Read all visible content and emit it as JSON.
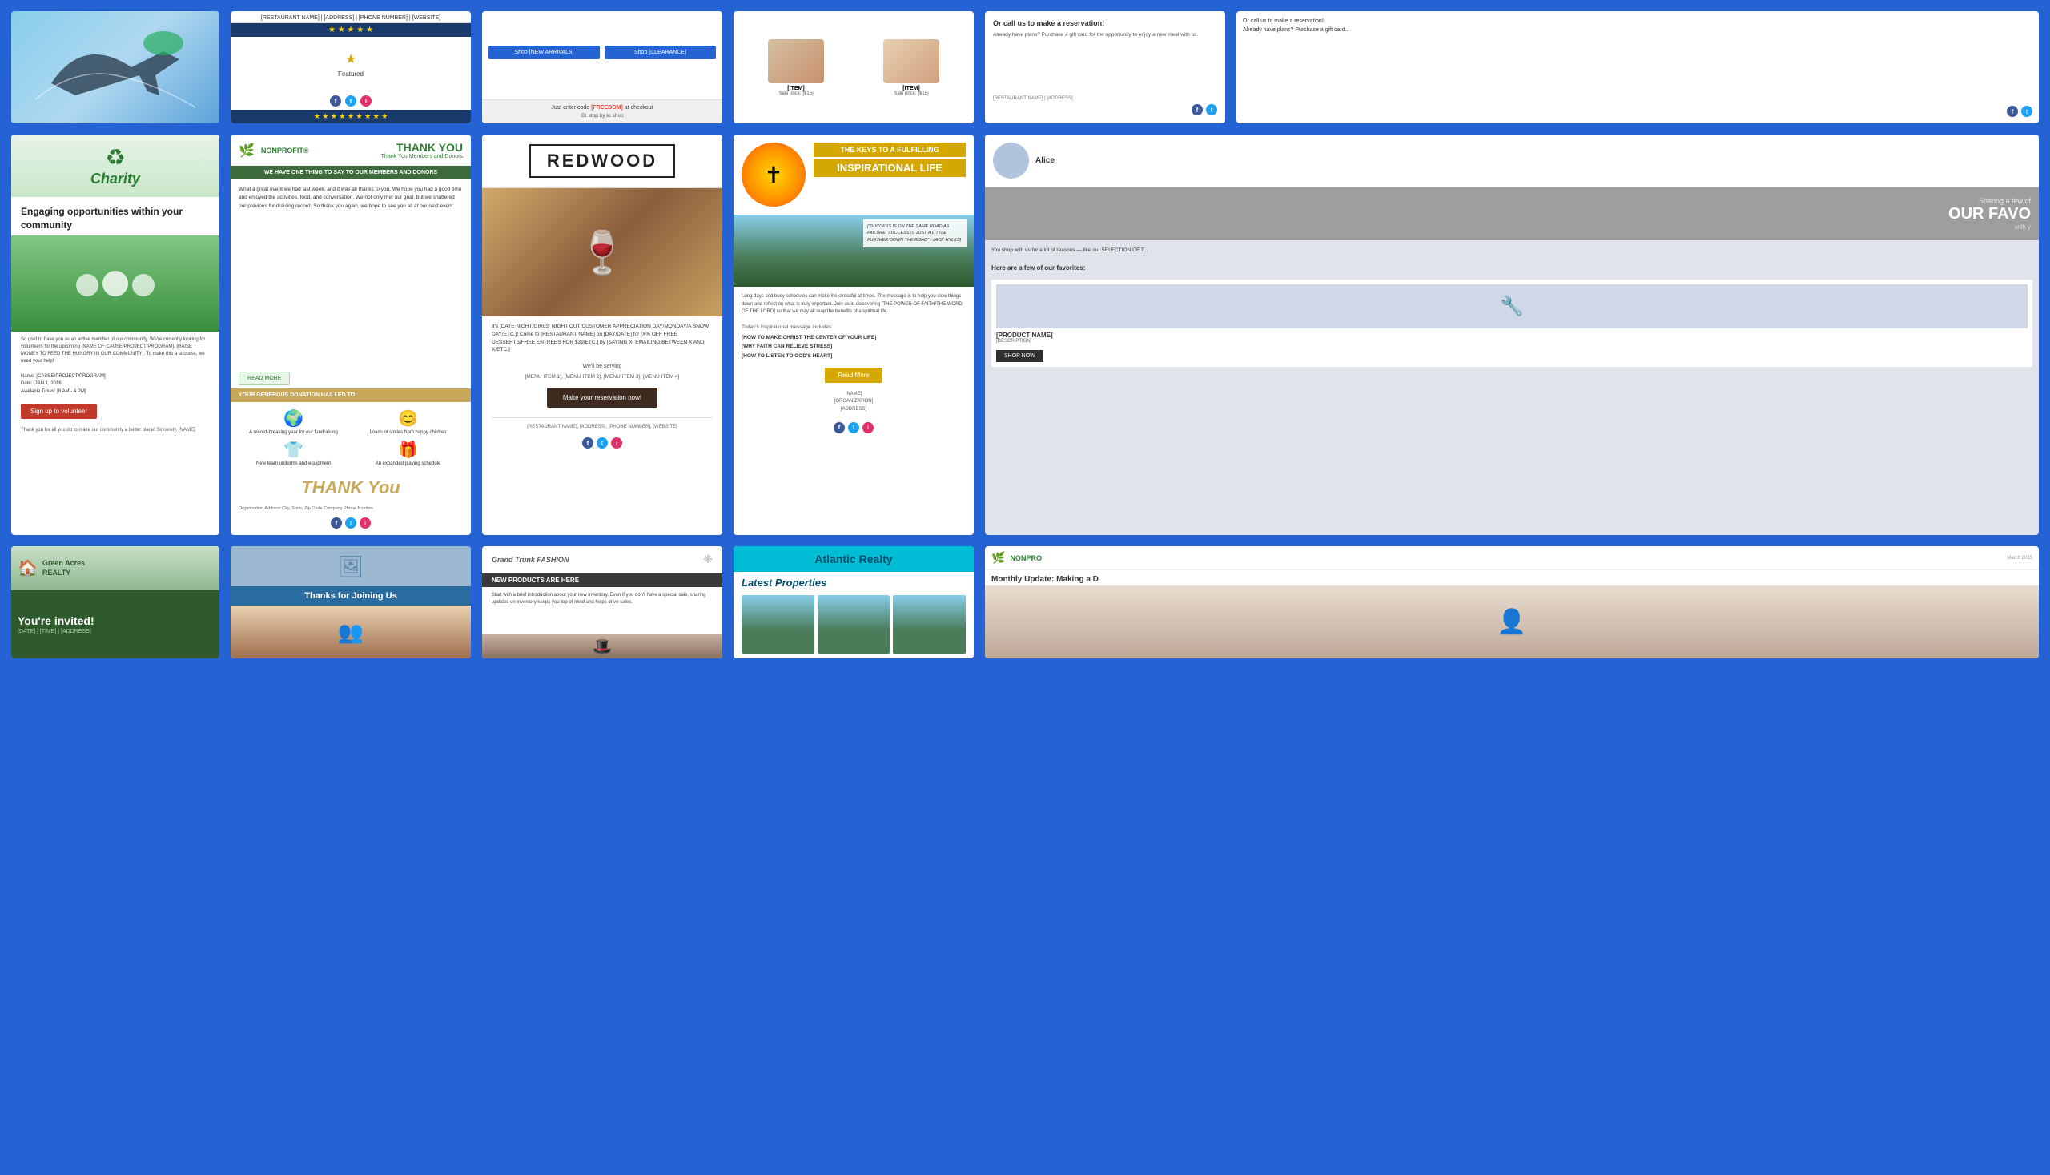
{
  "background_color": "#2563d4",
  "row1": {
    "cards": [
      {
        "id": "airplane",
        "type": "travel",
        "alt": "Airplane travel card with blue sky background"
      },
      {
        "id": "restaurant-stars",
        "type": "restaurant",
        "header": "[RESTAURANT NAME] | [ADDRESS] | [PHONE NUMBER] | [WEBSITE]",
        "star_row": "★ ★ ★ ★ ★",
        "bottom_stars": "★ ★ ★ ★ ★ ★ ★ ★ ★",
        "social": [
          "f",
          "t",
          "i"
        ]
      },
      {
        "id": "shop-sale",
        "type": "ecommerce",
        "btn1": "Shop [NEW ARRIVALS]",
        "btn2": "Shop [CLEARANCE]",
        "promo": "Just enter code [FREEDOM] at checkout",
        "sub": "Or stop by to shop"
      },
      {
        "id": "soap-products",
        "type": "product",
        "item1_label": "[ITEM]",
        "item1_price": "Sale price: [$15]",
        "item2_label": "[ITEM]",
        "item2_price": "Sale price: [$15]"
      },
      {
        "id": "gift-card",
        "type": "restaurant",
        "title": "Or call us to make a reservation!",
        "body": "Already have plans? Purchase a gift card for the opportunity to enjoy a new meal with us.",
        "footer": "[RESTAURANT NAME] | [ADDRESS]",
        "social": [
          "f",
          "t"
        ]
      }
    ]
  },
  "row2": {
    "cards": [
      {
        "id": "charity",
        "type": "nonprofit",
        "logo": "♻",
        "name": "Charity",
        "tagline": "Engaging opportunities within your community",
        "body": "So glad to have you as an active member of our community. We're currently looking for volunteers for the upcoming [NAME OF CAUSE/PROJECT/PROGRAM]. [RAISE MONEY TO FEED THE HUNGRY IN OUR COMMUNITY]. To make this a success, we need your help!",
        "fields": "Name: [CAUSE/PROJECT/PROGRAM]\nDate: [JAN 1, 2016]\nAvailable Times: [8 AM - 4 PM]",
        "btn": "Sign up to volunteer",
        "footer": "Thank you for all you do to make our community a better place!\nSincerely,\n[NAME]"
      },
      {
        "id": "nonprofit-thankyou",
        "type": "nonprofit",
        "brand": "NONPROFIT®",
        "title": "THANK YOU",
        "subtitle": "Thank You Members and Donors",
        "banner": "WE HAVE ONE THING TO SAY TO OUR MEMBERS AND DONORS",
        "body": "What a great event we had last week, and it was all thanks to you. We hope you had a good time and enjoyed the activities, food, and conversation. We not only met our goal, but we shattered our previous fundraising record. So thank you again, we hope to see you all at our next event.",
        "read_more": "READ MORE",
        "donation_header": "YOUR GENEROUS DONATION HAS LED TO:",
        "icon1_label": "A record-breaking year for our fundraising",
        "icon2_label": "Loads of smiles from happy children",
        "icon3_label": "New team uniforms and equipment",
        "icon4_label": "An expanded playing schedule",
        "thank_you_script": "THANK You",
        "footer": "Organization Address\nCity, State, Zip Code\nCompany Phone Number",
        "social": [
          "f",
          "t",
          "i"
        ]
      },
      {
        "id": "redwood-restaurant",
        "type": "restaurant",
        "brand": "REDWOOD",
        "event_text": "It's [DATE NIGHT/GIRLS' NIGHT OUT/CUSTOMER APPRECIATION DAY/MONDAY/A SNOW DAY/ETC.]! Come to [RESTAURANT NAME] on [DAY/DATE] for [X% OFF FREE DESSERTS/FREE ENTREES FOR $39/ETC.] by [SAYING X, EMAILING BETWEEN X AND X/ETC.]",
        "serving": "We'll be serving",
        "menu": "[MENU ITEM 1], [MENU ITEM 2], [MENU ITEM 3], [MENU ITEM 4]",
        "btn": "Make your reservation now!",
        "footer": "[RESTAURANT NAME], [ADDRESS], [PHONE NUMBER], [WEBSITE]",
        "social": [
          "f",
          "t",
          "i"
        ]
      },
      {
        "id": "inspirational-life",
        "type": "inspirational",
        "title_banner": "THE KEYS TO A FULFILLING",
        "subtitle": "INSPIRATIONAL LIFE",
        "quote": "[\"SUCCESS IS ON THE SAME ROAD AS FAILURE. SUCCESS IS JUST A LITTLE FURTHER DOWN THE ROAD\" - JACK HYLES]",
        "body": "Long days and busy schedules can make life stressful at times. The message is to help you slow things down and reflect on what is truly important. Join us in discovering [THE POWER OF FAITH/THE WORD OF THE LORD] so that we may all reap the benefits of a spiritual life.",
        "messages_header": "Today's inspirational message includes:",
        "message1": "[HOW TO MAKE CHRIST THE CENTER OF YOUR LIFE]",
        "message2": "[WHY FAITH CAN RELIEVE STRESS]",
        "message3": "[HOW TO LISTEN TO GOD'S HEART]",
        "btn": "Read More",
        "contact": "[NAME]\n[ORGANIZATION]\n[ADDRESS]",
        "social": [
          "f",
          "t",
          "i"
        ]
      },
      {
        "id": "favorites-partial",
        "type": "curated",
        "sharing": "Sharing a few of",
        "title": "OUR FAVO",
        "subtitle": "with y",
        "body": "You shop with us for a lot of reasons — like our SELECTION OF T...",
        "items_label": "Here are a few of our favorites:",
        "product_name": "[PRODUCT NAME]",
        "product_desc": "[DESCRIPTION]",
        "btn": "SHOP NOW"
      }
    ]
  },
  "row3": {
    "cards": [
      {
        "id": "green-acres-realty",
        "type": "realty",
        "brand_line1": "Green Acres",
        "brand_line2": "REALTY",
        "invited": "You're invited!",
        "details": "[DATE] | [TIME] | [ADDRESS]"
      },
      {
        "id": "thanks-for-joining",
        "type": "welcome",
        "banner": "Thanks for Joining Us",
        "icon": "🖼"
      },
      {
        "id": "grand-trunk-fashion",
        "type": "fashion",
        "brand": "Grand Trunk FASHION",
        "new_products": "NEW PRODUCTS ARE HERE",
        "body": "Start with a brief introduction about your new inventory. Even if you don't have a special sale, sharing updates on inventory keeps you top of mind and helps drive sales.",
        "hat_icon": "🎩"
      },
      {
        "id": "atlantic-realty",
        "type": "realty",
        "brand": "Atlantic Realty",
        "subtitle": "",
        "latest_label": "Latest Properties"
      },
      {
        "id": "nonprofit-monthly",
        "type": "nonprofit",
        "brand": "NONPRO",
        "date": "March 2015",
        "title": "Monthly Update: Making a D",
        "person_icon": "👤"
      }
    ]
  }
}
